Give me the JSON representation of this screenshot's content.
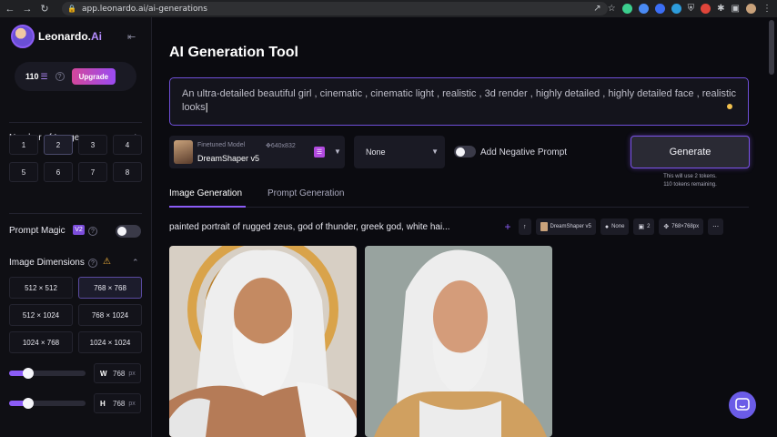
{
  "browser": {
    "url": "app.leonardo.ai/ai-generations"
  },
  "sidebar": {
    "brand_main": "Leonardo.",
    "brand_suffix": "Ai",
    "token_count": "110",
    "upgrade_label": "Upgrade",
    "num_images": {
      "title": "Number of Images",
      "options": [
        "1",
        "2",
        "3",
        "4",
        "5",
        "6",
        "7",
        "8"
      ],
      "selected": "2"
    },
    "prompt_magic": {
      "title": "Prompt Magic",
      "badge": "V2"
    },
    "image_dimensions": {
      "title": "Image Dimensions",
      "options": [
        "512 × 512",
        "768 × 768",
        "512 × 1024",
        "768 × 1024",
        "1024 × 768",
        "1024 × 1024"
      ],
      "selected": "768 × 768"
    },
    "width": {
      "label": "W",
      "value": "768",
      "unit": "px",
      "level": 0.25
    },
    "height": {
      "label": "H",
      "value": "768",
      "unit": "px",
      "level": 0.25
    }
  },
  "main": {
    "title": "AI Generation Tool",
    "prompt_text": "An ultra-detailed beautiful girl , cinematic , cinematic light , realistic , 3d render , highly detailed , highly detailed face , realistic looks",
    "model": {
      "subtitle": "Finetuned Model",
      "dims": "640x832",
      "name": "DreamShaper v5"
    },
    "style_select": "None",
    "negative_prompt_label": "Add Negative Prompt",
    "generate_label": "Generate",
    "generate_note_1": "This will use 2 tokens.",
    "generate_note_2": "110 tokens remaining.",
    "tabs": [
      "Image Generation",
      "Prompt Generation"
    ],
    "generation": {
      "prompt": "painted portrait of rugged zeus, god of thunder, greek god, white hai...",
      "chip_model": "DreamShaper v5",
      "chip_style": "None",
      "chip_count": "2",
      "chip_dims": "768×768px"
    }
  },
  "colors": {
    "accent": "#8b5cf6",
    "upgrade_gradient_start": "#d3479b",
    "upgrade_gradient_end": "#9a4bf2",
    "background": "#0b0b10"
  }
}
